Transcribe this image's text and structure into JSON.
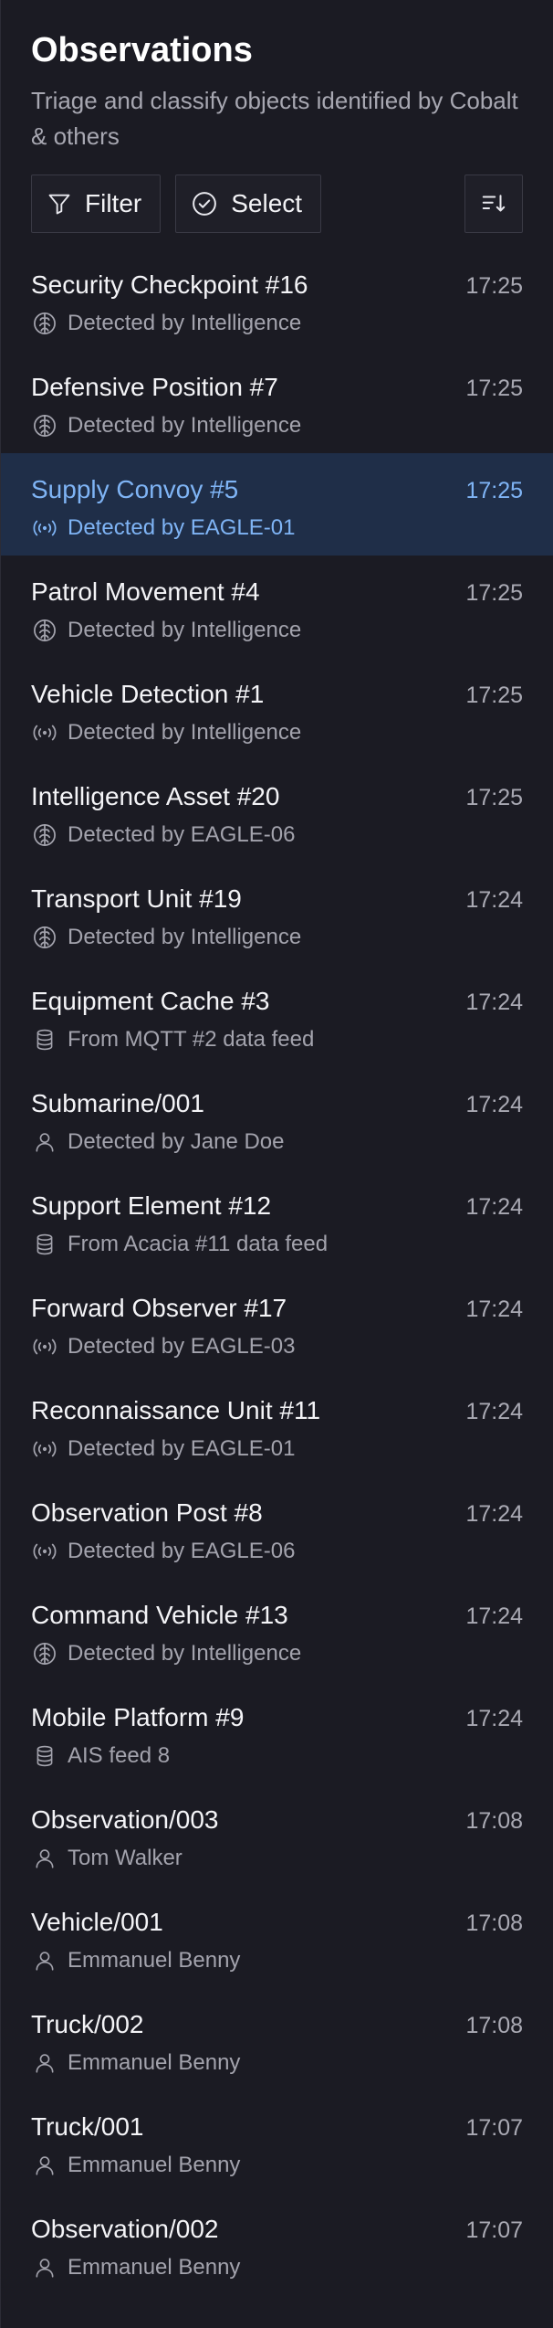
{
  "header": {
    "title": "Observations",
    "subtitle": "Triage and classify objects identified by Cobalt & others"
  },
  "toolbar": {
    "filter_label": "Filter",
    "select_label": "Select"
  },
  "colors": {
    "background": "#1b1b23",
    "selected_row": "#1f2e48",
    "selected_text": "#7fb4f5"
  },
  "observations": [
    {
      "name": "Security Checkpoint #16",
      "time": "17:25",
      "source": "Detected by Intelligence",
      "icon": "brain-icon",
      "selected": false
    },
    {
      "name": "Defensive Position #7",
      "time": "17:25",
      "source": "Detected by Intelligence",
      "icon": "brain-icon",
      "selected": false
    },
    {
      "name": "Supply Convoy #5",
      "time": "17:25",
      "source": "Detected by EAGLE-01",
      "icon": "sensor-icon",
      "selected": true
    },
    {
      "name": "Patrol Movement #4",
      "time": "17:25",
      "source": "Detected by Intelligence",
      "icon": "brain-icon",
      "selected": false
    },
    {
      "name": "Vehicle Detection #1",
      "time": "17:25",
      "source": "Detected by Intelligence",
      "icon": "sensor-icon",
      "selected": false
    },
    {
      "name": "Intelligence Asset #20",
      "time": "17:25",
      "source": "Detected by EAGLE-06",
      "icon": "brain-icon",
      "selected": false
    },
    {
      "name": "Transport Unit #19",
      "time": "17:24",
      "source": "Detected by Intelligence",
      "icon": "brain-icon",
      "selected": false
    },
    {
      "name": "Equipment Cache #3",
      "time": "17:24",
      "source": "From MQTT #2 data feed",
      "icon": "database-icon",
      "selected": false
    },
    {
      "name": "Submarine/001",
      "time": "17:24",
      "source": "Detected by Jane Doe",
      "icon": "user-icon",
      "selected": false
    },
    {
      "name": "Support Element #12",
      "time": "17:24",
      "source": "From Acacia #11 data feed",
      "icon": "database-icon",
      "selected": false
    },
    {
      "name": "Forward Observer #17",
      "time": "17:24",
      "source": "Detected by EAGLE-03",
      "icon": "sensor-icon",
      "selected": false
    },
    {
      "name": "Reconnaissance Unit #11",
      "time": "17:24",
      "source": "Detected by EAGLE-01",
      "icon": "sensor-icon",
      "selected": false
    },
    {
      "name": "Observation Post #8",
      "time": "17:24",
      "source": "Detected by EAGLE-06",
      "icon": "sensor-icon",
      "selected": false
    },
    {
      "name": "Command Vehicle #13",
      "time": "17:24",
      "source": "Detected by Intelligence",
      "icon": "brain-icon",
      "selected": false
    },
    {
      "name": "Mobile Platform #9",
      "time": "17:24",
      "source": "AIS feed 8",
      "icon": "database-icon",
      "selected": false
    },
    {
      "name": "Observation/003",
      "time": "17:08",
      "source": "Tom Walker",
      "icon": "user-icon",
      "selected": false
    },
    {
      "name": "Vehicle/001",
      "time": "17:08",
      "source": "Emmanuel Benny",
      "icon": "user-icon",
      "selected": false
    },
    {
      "name": "Truck/002",
      "time": "17:08",
      "source": "Emmanuel Benny",
      "icon": "user-icon",
      "selected": false
    },
    {
      "name": "Truck/001",
      "time": "17:07",
      "source": "Emmanuel Benny",
      "icon": "user-icon",
      "selected": false
    },
    {
      "name": "Observation/002",
      "time": "17:07",
      "source": "Emmanuel Benny",
      "icon": "user-icon",
      "selected": false
    }
  ]
}
